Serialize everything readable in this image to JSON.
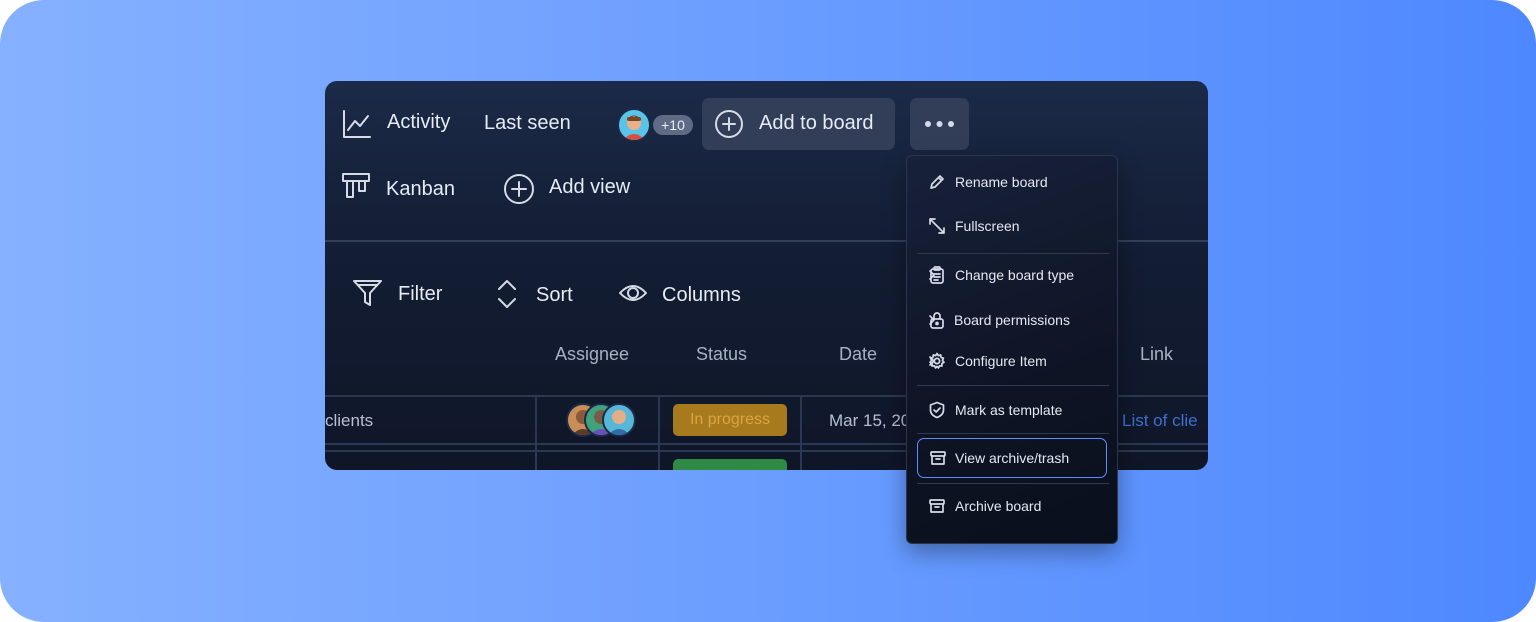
{
  "toolbar": {
    "activity_label": "Activity",
    "last_seen_label": "Last seen",
    "viewer_count": "+10",
    "add_to_board_label": "Add to board",
    "more_label": "•••"
  },
  "views": {
    "kanban_label": "Kanban",
    "add_view_label": "Add view"
  },
  "table_controls": {
    "filter_label": "Filter",
    "sort_label": "Sort",
    "columns_label": "Columns"
  },
  "table": {
    "headers": {
      "assignee": "Assignee",
      "status": "Status",
      "date": "Date",
      "link": "Link"
    },
    "rows": [
      {
        "name": "clients",
        "status": "In progress",
        "date": "Mar 15, 20",
        "link": "List of clie"
      },
      {
        "name": "",
        "status": "",
        "date": "",
        "link": ""
      }
    ]
  },
  "menu": {
    "items": [
      {
        "label": "Rename board",
        "icon": "pencil-icon"
      },
      {
        "label": "Fullscreen",
        "icon": "expand-arrows-icon"
      },
      {
        "label": "Change board type",
        "icon": "clipboard-icon",
        "submenu": true
      },
      {
        "label": "Board permissions",
        "icon": "lock-icon",
        "submenu": true
      },
      {
        "label": "Configure Item",
        "icon": "gear-icon",
        "submenu": true
      },
      {
        "label": "Mark as template",
        "icon": "shield-check-icon"
      },
      {
        "label": "View archive/trash",
        "icon": "archive-box-icon",
        "highlighted": true
      },
      {
        "label": "Archive board",
        "icon": "archive-box-icon"
      }
    ]
  },
  "colors": {
    "background_gradient": [
      "#86b1ff",
      "#4e88ff"
    ],
    "panel": "#131d33",
    "status_in_progress": "#a77a1d",
    "status_done": "#2e8a45",
    "link": "#3f6fd1",
    "highlight_border": "#5f8cff"
  }
}
